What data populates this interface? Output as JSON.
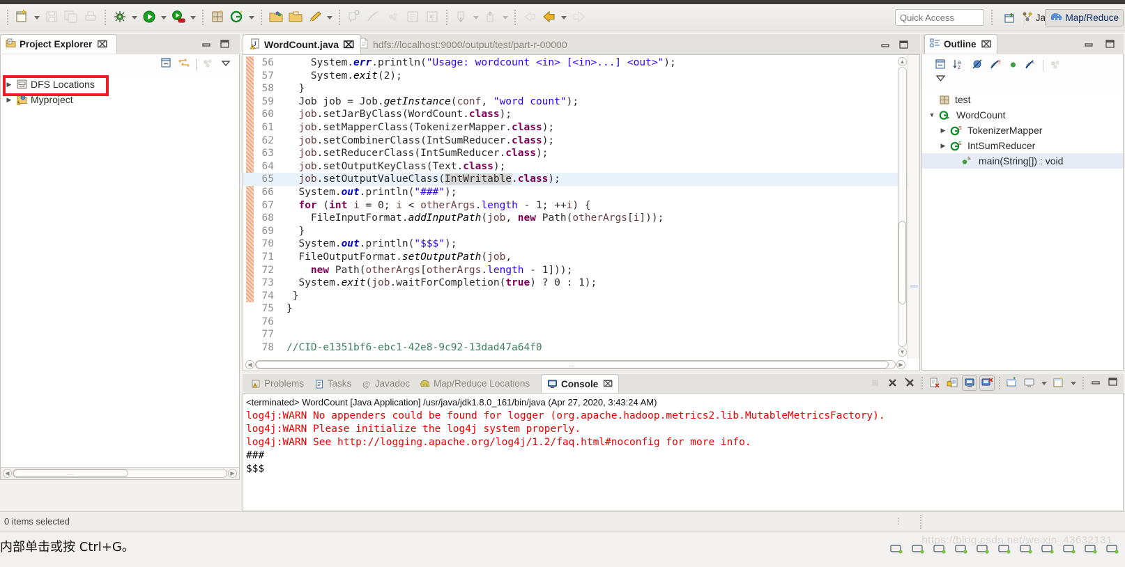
{
  "window": {
    "quick_access_placeholder": "Quick Access"
  },
  "toolbar": {
    "groups": [
      {
        "items": [
          {
            "name": "new-wizard-button",
            "icon": "new-file-icon",
            "arrow": true,
            "enabled": true
          },
          {
            "name": "save-button",
            "icon": "save-icon",
            "arrow": false,
            "enabled": false
          },
          {
            "name": "save-all-button",
            "icon": "save-all-icon",
            "arrow": false,
            "enabled": false
          },
          {
            "name": "print-button",
            "icon": "print-icon",
            "arrow": false,
            "enabled": false
          }
        ]
      },
      {
        "items": [
          {
            "name": "debug-button",
            "icon": "bug-icon",
            "arrow": true,
            "enabled": true
          },
          {
            "name": "run-button",
            "icon": "run-icon",
            "arrow": true,
            "enabled": true
          },
          {
            "name": "run-external-tools-button",
            "icon": "external-tools-icon",
            "arrow": true,
            "enabled": true
          }
        ]
      },
      {
        "items": [
          {
            "name": "new-java-package-button",
            "icon": "package-icon",
            "arrow": false,
            "enabled": true
          },
          {
            "name": "new-java-class-button",
            "icon": "java-class-icon",
            "arrow": true,
            "enabled": true
          }
        ]
      },
      {
        "items": [
          {
            "name": "open-type-button",
            "icon": "open-type-icon",
            "arrow": false,
            "enabled": true
          },
          {
            "name": "open-task-button",
            "icon": "open-folder-icon",
            "arrow": false,
            "enabled": true
          },
          {
            "name": "search-button",
            "icon": "search-pencil-icon",
            "arrow": true,
            "enabled": true
          }
        ]
      },
      {
        "items": [
          {
            "name": "last-edit-location-button",
            "icon": "last-edit-icon",
            "arrow": false,
            "enabled": false
          },
          {
            "name": "toggle-mark-occurrences-button",
            "icon": "mark-occurrences-icon",
            "arrow": false,
            "enabled": false
          },
          {
            "name": "skip-breakpoints-button",
            "icon": "skip-breakpoints-icon",
            "arrow": false,
            "enabled": false
          },
          {
            "name": "toggle-block-selection-button",
            "icon": "block-selection-icon",
            "arrow": false,
            "enabled": false
          },
          {
            "name": "show-whitespace-button",
            "icon": "pilcrow-icon",
            "arrow": false,
            "enabled": false
          }
        ]
      },
      {
        "items": [
          {
            "name": "next-annotation-button",
            "icon": "next-annotation-icon",
            "arrow": true,
            "enabled": false
          },
          {
            "name": "previous-annotation-button",
            "icon": "previous-annotation-icon",
            "arrow": true,
            "enabled": false
          }
        ]
      },
      {
        "items": [
          {
            "name": "back-to-button",
            "icon": "back-left-arrow-icon",
            "arrow": false,
            "enabled": false
          },
          {
            "name": "back-button",
            "icon": "back-arrow-icon",
            "arrow": true,
            "enabled": true
          },
          {
            "name": "forward-button",
            "icon": "forward-arrow-icon",
            "arrow": false,
            "enabled": false
          }
        ]
      }
    ],
    "open_perspective_icon": "open-perspective-icon",
    "perspectives": [
      {
        "name": "perspective-java-ee",
        "label": "Java EE",
        "icon": "java-ee-icon",
        "active": false
      },
      {
        "name": "perspective-map-reduce",
        "label": "Map/Reduce",
        "icon": "elephant-icon",
        "active": true
      }
    ]
  },
  "project_explorer": {
    "tab_label": "Project Explorer",
    "tab_icon": "project-explorer-icon",
    "close_glyph": "⌧",
    "toolbar": [
      {
        "name": "collapse-all-button",
        "icon": "collapse-all-icon"
      },
      {
        "name": "link-with-editor-button",
        "icon": "link-editor-icon"
      },
      {
        "name": "focus-on-active-task-button",
        "icon": "focus-task-icon"
      },
      {
        "name": "view-menu-button",
        "icon": "view-menu-icon"
      }
    ],
    "tree": [
      {
        "name": "tree-item-dfs-locations",
        "label": "DFS Locations",
        "icon": "dfs-locations-icon",
        "expanded": false,
        "highlighted": true
      },
      {
        "name": "tree-item-myproject",
        "label": "Myproject",
        "icon": "java-project-warning-icon",
        "expanded": false,
        "highlighted": false
      }
    ],
    "highlight_color": "#ee1d23"
  },
  "editor": {
    "tabs": [
      {
        "name": "editor-tab-wordcount",
        "label": "WordCount.java",
        "icon": "java-file-warning-icon",
        "active": true,
        "close_glyph": "⌧"
      },
      {
        "name": "editor-tab-part-r-00000",
        "label": "hdfs://localhost:9000/output/test/part-r-00000",
        "icon": "text-file-icon",
        "active": false,
        "close_glyph": ""
      }
    ],
    "minimize_icon": "minimize-icon",
    "maximize_icon": "maximize-icon",
    "first_line": 56,
    "highlighted_line": 65,
    "change_bar_from": 56,
    "change_bar_to": 74,
    "lines": [
      {
        "no": 56,
        "html": "    System.<span class=\"sf\">err</span>.println(<span class=\"s\">\"Usage: wordcount &lt;in&gt; [&lt;in&gt;...] &lt;out&gt;\"</span>);"
      },
      {
        "no": 57,
        "html": "    System.<span class=\"f\">exit</span>(2);"
      },
      {
        "no": 58,
        "html": "  }"
      },
      {
        "no": 59,
        "html": "  Job job = Job.<span class=\"f\">getInstance</span>(<span class=\"n\">conf</span>, <span class=\"s\">\"word count\"</span>);"
      },
      {
        "no": 60,
        "html": "  <span class=\"n\">job</span>.setJarByClass(WordCount.<span class=\"k\">class</span>);"
      },
      {
        "no": 61,
        "html": "  <span class=\"n\">job</span>.setMapperClass(TokenizerMapper.<span class=\"k\">class</span>);"
      },
      {
        "no": 62,
        "html": "  <span class=\"n\">job</span>.setCombinerClass(IntSumReducer.<span class=\"k\">class</span>);"
      },
      {
        "no": 63,
        "html": "  <span class=\"n\">job</span>.setReducerClass(IntSumReducer.<span class=\"k\">class</span>);"
      },
      {
        "no": 64,
        "html": "  <span class=\"n\">job</span>.setOutputKeyClass(Text.<span class=\"k\">class</span>);"
      },
      {
        "no": 65,
        "html": "  <span class=\"n\">job</span>.setOutputValueClass(<span class=\"occ\">IntWritable</span>.<span class=\"k\">class</span>);"
      },
      {
        "no": 66,
        "html": "  System.<span class=\"sf\">out</span>.println(<span class=\"s\">\"###\"</span>);"
      },
      {
        "no": 67,
        "html": "  <span class=\"k\">for</span> (<span class=\"k\">int</span> <span class=\"n\">i</span> = 0; <span class=\"n\">i</span> &lt; <span class=\"n\">otherArgs</span>.<span class=\"s\">length</span> - 1; ++<span class=\"n\">i</span>) {"
      },
      {
        "no": 68,
        "html": "    FileInputFormat.<span class=\"f\">addInputPath</span>(<span class=\"n\">job</span>, <span class=\"k\">new</span> Path(<span class=\"n\">otherArgs</span>[<span class=\"n\">i</span>]));"
      },
      {
        "no": 69,
        "html": "  }"
      },
      {
        "no": 70,
        "html": "  System.<span class=\"sf\">out</span>.println(<span class=\"s\">\"$$$\"</span>);"
      },
      {
        "no": 71,
        "html": "  FileOutputFormat.<span class=\"f\">setOutputPath</span>(<span class=\"n\">job</span>,"
      },
      {
        "no": 72,
        "html": "    <span class=\"k\">new</span> Path(<span class=\"n\">otherArgs</span>[<span class=\"n\">otherArgs</span>.<span class=\"s\">length</span> - 1]));"
      },
      {
        "no": 73,
        "html": "  System.<span class=\"f\">exit</span>(<span class=\"n\">job</span>.waitForCompletion(<span class=\"k\">true</span>) ? 0 : 1);"
      },
      {
        "no": 74,
        "html": " }"
      },
      {
        "no": 75,
        "html": "}"
      },
      {
        "no": 76,
        "html": ""
      },
      {
        "no": 77,
        "html": ""
      },
      {
        "no": 78,
        "html": "<span class=\"cm\">//CID-e1351bf6-ebc1-42e8-9c92-13dad47a64f0</span>"
      }
    ]
  },
  "outline": {
    "tab_label": "Outline",
    "tab_icon": "outline-icon",
    "close_glyph": "⌧",
    "minimize_icon": "minimize-icon",
    "maximize_icon": "maximize-icon",
    "toolbar": [
      {
        "name": "collapse-all-button",
        "icon": "collapse-all-icon"
      },
      {
        "name": "sort-button",
        "icon": "sort-az-icon"
      },
      {
        "name": "hide-fields-button",
        "icon": "hide-fields-icon"
      },
      {
        "name": "hide-static-button",
        "icon": "hide-static-icon"
      },
      {
        "name": "hide-non-public-button",
        "icon": "hide-non-public-icon"
      },
      {
        "name": "hide-local-types-button",
        "icon": "hide-local-types-icon"
      },
      {
        "name": "focus-on-active-task-button",
        "icon": "focus-task-icon"
      }
    ],
    "view_menu_icon": "view-menu-icon",
    "tree": [
      {
        "name": "outline-item-test",
        "label": "test",
        "icon": "package-icon",
        "indent": 0,
        "twisty": "",
        "selected": false
      },
      {
        "name": "outline-item-wordcount",
        "label": "WordCount",
        "icon": "class-public-icon",
        "indent": 0,
        "twisty": "down",
        "selected": false
      },
      {
        "name": "outline-item-tokenizermapper",
        "label": "TokenizerMapper",
        "icon": "class-static-icon",
        "indent": 1,
        "twisty": "right",
        "selected": false
      },
      {
        "name": "outline-item-intsumreducer",
        "label": "IntSumReducer",
        "icon": "class-static-icon",
        "indent": 1,
        "twisty": "right",
        "selected": false
      },
      {
        "name": "outline-item-main",
        "label": "main(String[]) : void",
        "icon": "method-public-static-icon",
        "indent": 2,
        "twisty": "",
        "selected": true
      }
    ]
  },
  "console": {
    "tabs": [
      {
        "name": "tab-problems",
        "label": "Problems",
        "icon": "problems-icon",
        "active": false
      },
      {
        "name": "tab-tasks",
        "label": "Tasks",
        "icon": "tasks-icon",
        "active": false
      },
      {
        "name": "tab-javadoc",
        "label": "Javadoc",
        "icon": "javadoc-at-icon",
        "active": false
      },
      {
        "name": "tab-map-reduce-locations",
        "label": "Map/Reduce Locations",
        "icon": "elephant-icon",
        "active": false
      },
      {
        "name": "tab-console",
        "label": "Console",
        "icon": "console-icon",
        "active": true,
        "close_glyph": "⌧"
      }
    ],
    "toolbar": [
      {
        "name": "terminate-button",
        "icon": "terminate-icon",
        "enabled": false,
        "toggled": false
      },
      {
        "name": "remove-launch-button",
        "icon": "remove-launch-icon",
        "enabled": true,
        "toggled": false
      },
      {
        "name": "remove-all-terminated-button",
        "icon": "remove-all-icon",
        "enabled": true,
        "toggled": false
      },
      {
        "name": "clear-console-button",
        "icon": "clear-console-icon",
        "enabled": true,
        "toggled": false
      },
      {
        "name": "scroll-lock-button",
        "icon": "scroll-lock-icon",
        "enabled": true,
        "toggled": false
      },
      {
        "name": "pin-console-button",
        "icon": "pin-console-icon",
        "enabled": true,
        "toggled": true
      },
      {
        "name": "display-selected-console-button",
        "icon": "display-console-icon",
        "enabled": true,
        "toggled": true
      },
      {
        "name": "open-console-button",
        "icon": "open-console-icon",
        "enabled": true,
        "toggled": false
      },
      {
        "name": "show-console-view-button",
        "icon": "show-console-icon",
        "enabled": true,
        "toggled": false,
        "arrow": true
      },
      {
        "name": "new-console-view-button",
        "icon": "new-console-icon",
        "enabled": true,
        "toggled": false,
        "arrow": true
      },
      {
        "name": "minimize-button",
        "icon": "minimize-icon",
        "enabled": true,
        "toggled": false
      },
      {
        "name": "maximize-button",
        "icon": "maximize-icon",
        "enabled": true,
        "toggled": false
      }
    ],
    "header_line": "<terminated> WordCount [Java Application] /usr/java/jdk1.8.0_161/bin/java (Apr 27, 2020, 3:43:24 AM)",
    "output": [
      {
        "text": "log4j:WARN No appenders could be found for logger (org.apache.hadoop.metrics2.lib.MutableMetricsFactory).",
        "stream": "err"
      },
      {
        "text": "log4j:WARN Please initialize the log4j system properly.",
        "stream": "err"
      },
      {
        "text": "log4j:WARN See http://logging.apache.org/log4j/1.2/faq.html#noconfig for more info.",
        "stream": "err"
      },
      {
        "text": "###",
        "stream": "out"
      },
      {
        "text": "$$$",
        "stream": "out"
      }
    ],
    "error_color": "#ee0000"
  },
  "status_bar": {
    "text": "0 items selected"
  },
  "host_bar": {
    "text": "内部单击或按 Ctrl+G。",
    "watermark": "https://blog.csdn.net/weixin_43632131",
    "icons": [
      {
        "name": "hard-disk-icon"
      },
      {
        "name": "optical-drive-icon"
      },
      {
        "name": "cd-drive-icon"
      },
      {
        "name": "network-adapter-icon"
      },
      {
        "name": "printer-icon"
      },
      {
        "name": "sound-icon"
      },
      {
        "name": "usb-icon"
      },
      {
        "name": "floppy-icon"
      },
      {
        "name": "folder-share-icon"
      },
      {
        "name": "archive-icon"
      },
      {
        "name": "display-icon"
      }
    ]
  }
}
